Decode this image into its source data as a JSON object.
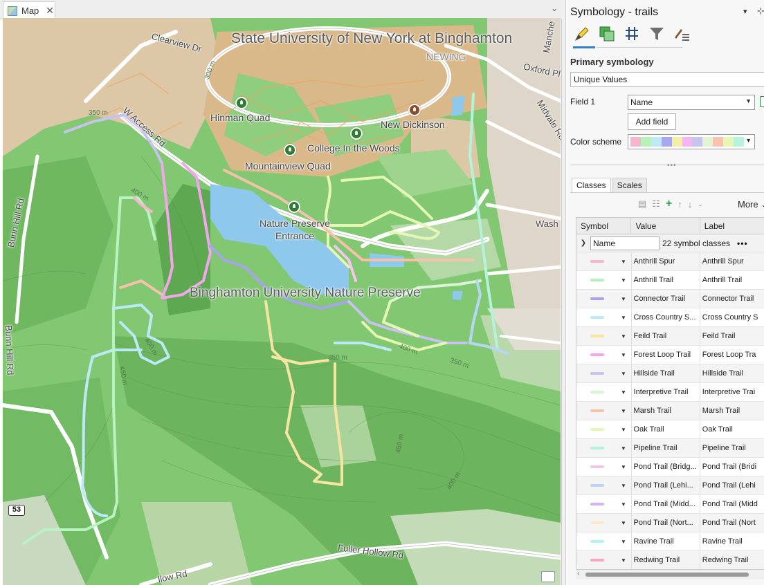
{
  "map_tab": {
    "label": "Map",
    "close": "✕",
    "menu": "⌄"
  },
  "map": {
    "places": {
      "suny": "State University of New York at Binghamton",
      "newing": "NEWING",
      "hinman": "Hinman Quad",
      "new_dickinson": "New Dickinson",
      "college_woods": "College In the Woods",
      "mountainview": "Mountainview Quad",
      "nature_entrance": "Nature Preserve Entrance",
      "bu_nature": "Binghamton University Nature Preserve"
    },
    "roads": {
      "clearview": "Clearview Dr",
      "w_access": "W Access Rd",
      "bunn_hill_1": "Bunn Hill Rd",
      "bunn_hill_2": "Bunn Hill Rd",
      "oxford": "Oxford Pl",
      "midvale": "Midvale Rd",
      "manche": "Manche",
      "wash": "Wash",
      "fuller_hollow": "Fuller Hollow Rd",
      "bottom": "llow Rd"
    },
    "contours": [
      "350 m",
      "300 m",
      "400 m",
      "400 m",
      "450 m",
      "350 m",
      "450 m",
      "400 m",
      "350 m",
      "400 m"
    ],
    "route_shield": "53"
  },
  "symbology": {
    "title": "Symbology - trails",
    "pin": "▾",
    "close": "⊹",
    "primary_label": "Primary symbology",
    "primary_value": "Unique Values",
    "field1_label": "Field 1",
    "field1_value": "Name",
    "add_field": "Add field",
    "color_scheme_label": "Color scheme",
    "color_scheme": [
      "#f7b6cd",
      "#b7f3b9",
      "#bfe9f5",
      "#a8a8f0",
      "#f3f0a6",
      "#f8b4f0",
      "#c9c3f0",
      "#dff5d4",
      "#f9c3b0",
      "#e6f7b4",
      "#b9f2de"
    ],
    "tabs": [
      "Classes",
      "Scales"
    ],
    "more_label": "More ⌄",
    "columns": [
      "Symbol",
      "Value",
      "Label"
    ],
    "group_field": "Name",
    "group_count": "22 symbol classes",
    "classes": [
      {
        "value": "Anthrill Spur",
        "label": "Anthrill Spur",
        "color": "#f7b6cd"
      },
      {
        "value": "Anthrill Trail",
        "label": "Anthrill Trail",
        "color": "#b7f0b8"
      },
      {
        "value": "Connector Trail",
        "label": "Connector Trail",
        "color": "#a6a4ea"
      },
      {
        "value": "Cross Country S...",
        "label": "Cross Country S",
        "color": "#bce9f6"
      },
      {
        "value": "Feild Trail",
        "label": "Feild Trail",
        "color": "#f6e6a2"
      },
      {
        "value": "Forest Loop Trail",
        "label": "Forest Loop Tra",
        "color": "#f3a6ec"
      },
      {
        "value": "Hillside Trail",
        "label": "Hillside Trail",
        "color": "#c7c2ee"
      },
      {
        "value": "Interpretive Trail",
        "label": "Interpretive Trai",
        "color": "#dcf3d6"
      },
      {
        "value": "Marsh Trail",
        "label": "Marsh Trail",
        "color": "#f6c2ab"
      },
      {
        "value": "Oak Trail",
        "label": "Oak Trail",
        "color": "#e4f7b4"
      },
      {
        "value": "Pipeline Trail",
        "label": "Pipeline Trail",
        "color": "#b4f2da"
      },
      {
        "value": "Pond Trail (Bridg...",
        "label": "Pond Trail (Bridi",
        "color": "#f6c6ef"
      },
      {
        "value": "Pond Trail (Lehi...",
        "label": "Pond Trail (Lehi",
        "color": "#b7d6f4"
      },
      {
        "value": "Pond Trail (Midd...",
        "label": "Pond Trail (Midd",
        "color": "#d2b5f2"
      },
      {
        "value": "Pond Trail (Nort...",
        "label": "Pond Trail (Nort",
        "color": "#faeac6"
      },
      {
        "value": "Ravine Trail",
        "label": "Ravine Trail",
        "color": "#b5f3f1"
      },
      {
        "value": "Redwing Trail",
        "label": "Redwing Trail",
        "color": "#f4a8c2"
      }
    ]
  }
}
